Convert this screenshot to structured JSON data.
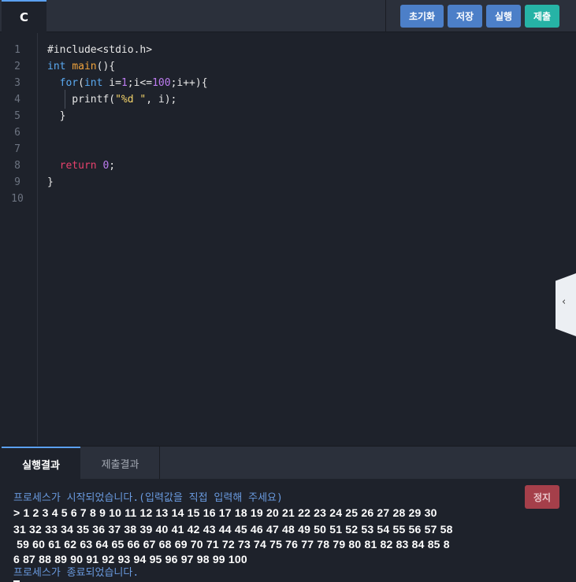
{
  "header": {
    "language_tab": "C",
    "buttons": {
      "reset": "초기화",
      "save": "저장",
      "run": "실행",
      "submit": "제출"
    }
  },
  "editor": {
    "line_numbers": [
      "1",
      "2",
      "3",
      "4",
      "5",
      "6",
      "7",
      "8",
      "9",
      "10"
    ],
    "lines": [
      "#include<stdio.h>",
      "int main(){",
      "  for(int i=1;i<=100;i++){",
      "    printf(\"%d \", i);",
      "  }",
      "",
      "",
      "  return 0;",
      "}",
      ""
    ]
  },
  "bottom_tabs": {
    "run_result": "실행결과",
    "submit_result": "제출결과"
  },
  "console": {
    "stop_button": "정지",
    "start_message": "프로세스가 시작되었습니다.(입력값을 직접 입력해 주세요)",
    "output_lines": [
      "> 1 2 3 4 5 6 7 8 9 10 11 12 13 14 15 16 17 18 19 20 21 22 23 24 25 26 27 28 29 30",
      "31 32 33 34 35 36 37 38 39 40 41 42 43 44 45 46 47 48 49 50 51 52 53 54 55 56 57 58",
      " 59 60 61 62 63 64 65 66 67 68 69 70 71 72 73 74 75 76 77 78 79 80 81 82 83 84 85 8",
      "6 87 88 89 90 91 92 93 94 95 96 97 98 99 100"
    ],
    "end_message": "프로세스가 종료되었습니다."
  }
}
